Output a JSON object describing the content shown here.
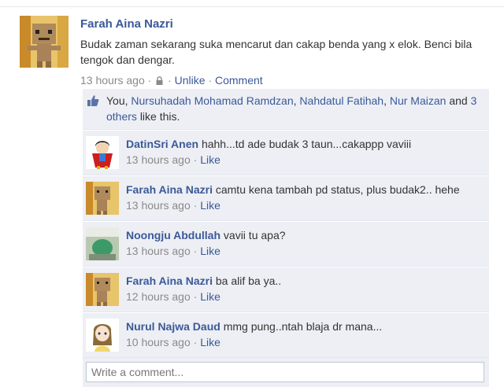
{
  "post": {
    "author": "Farah Aina Nazri",
    "text": "Budak zaman sekarang suka mencarut dan cakap benda yang x elok. Benci bila tengok dan dengar.",
    "time": "13 hours ago",
    "separator": "·",
    "unlike_label": "Unlike",
    "comment_label": "Comment",
    "privacy_icon": "lock-icon"
  },
  "likes": {
    "you": "You,",
    "people": [
      "Nursuhadah Mohamad Ramdzan",
      "Nahdatul Fatihah",
      "Nur Maizan"
    ],
    "and": "and",
    "others_link": "3 others",
    "suffix": "like this.",
    "icon": "thumbs-up-icon"
  },
  "comments": [
    {
      "author": "DatinSri Anen",
      "text": "hahh...td ade budak 3 taun...cakappp vaviii",
      "time": "13 hours ago",
      "like_label": "Like"
    },
    {
      "author": "Farah Aina Nazri",
      "text": "camtu kena tambah pd status, plus budak2.. hehe",
      "time": "13 hours ago",
      "like_label": "Like"
    },
    {
      "author": "Noongju Abdullah",
      "text": "vavii tu apa?",
      "time": "13 hours ago",
      "like_label": "Like"
    },
    {
      "author": "Farah Aina Nazri",
      "text": "ba alif ba ya..",
      "time": "12 hours ago",
      "like_label": "Like"
    },
    {
      "author": "Nurul Najwa Daud",
      "text": "mmg pung..ntah blaja dr mana...",
      "time": "10 hours ago",
      "like_label": "Like"
    }
  ],
  "compose": {
    "placeholder": "Write a comment..."
  },
  "colors": {
    "link": "#3b5998",
    "panel": "#edeff4",
    "meta": "#8a8a8a"
  }
}
